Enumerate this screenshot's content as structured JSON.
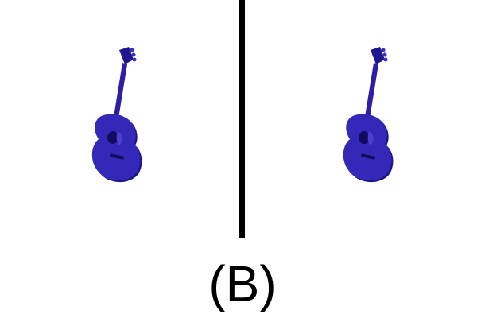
{
  "caption": {
    "text": "(B)"
  },
  "panels": [
    {
      "object": "acoustic-guitar",
      "color": "#2a1fa6"
    },
    {
      "object": "acoustic-guitar",
      "color": "#2a1fa6"
    }
  ],
  "divider_color": "#000000"
}
